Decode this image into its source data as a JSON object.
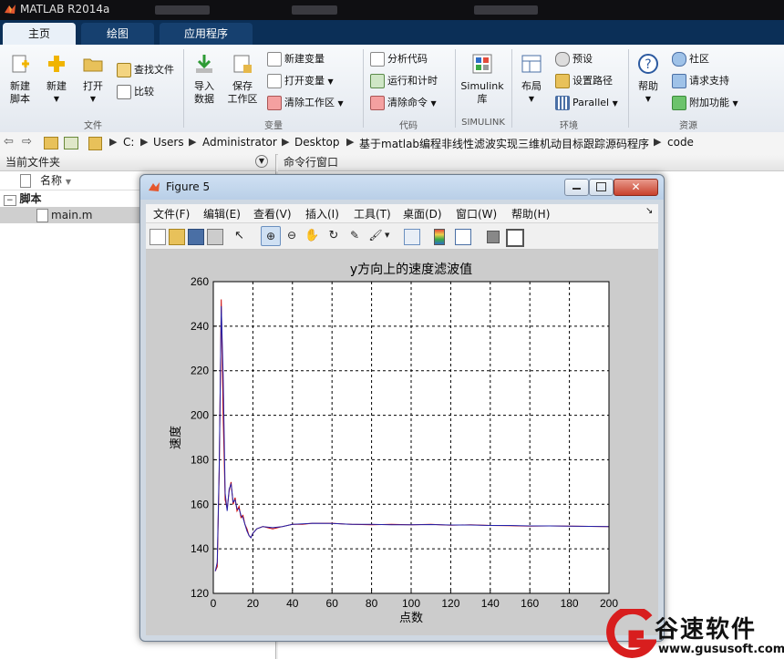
{
  "app": {
    "title": "MATLAB R2014a"
  },
  "tabs": [
    {
      "label": "主页",
      "active": true
    },
    {
      "label": "绘图",
      "active": false
    },
    {
      "label": "应用程序",
      "active": false
    }
  ],
  "ribbon": {
    "file_group": {
      "label": "文件",
      "new_script": "新建\n脚本",
      "new": "新建",
      "open": "打开",
      "find_files": "查找文件",
      "compare": "比较"
    },
    "variable_group": {
      "label": "变量",
      "import_data": "导入\n数据",
      "save_workspace": "保存\n工作区",
      "new_variable": "新建变量",
      "open_variable": "打开变量",
      "clear_workspace": "清除工作区"
    },
    "code_group": {
      "label": "代码",
      "analyze_code": "分析代码",
      "run_and_time": "运行和计时",
      "clear_commands": "清除命令"
    },
    "simulink_group": {
      "label": "SIMULINK",
      "simulink_library": "Simulink\n库"
    },
    "environment_group": {
      "label": "环境",
      "layout": "布局",
      "preferences": "预设",
      "set_path": "设置路径",
      "parallel": "Parallel"
    },
    "resources_group": {
      "label": "资源",
      "help": "帮助",
      "community": "社区",
      "request_support": "请求支持",
      "add_ons": "附加功能"
    }
  },
  "address": {
    "crumbs": [
      "C:",
      "Users",
      "Administrator",
      "Desktop",
      "基于matlab编程非线性滤波实现三维机动目标跟踪源码程序",
      "code"
    ]
  },
  "current_folder": {
    "title": "当前文件夹",
    "column_name": "名称",
    "group": "脚本",
    "file": "main.m"
  },
  "command_window": {
    "title": "命令行窗口"
  },
  "figure": {
    "title": "Figure 5",
    "menu": [
      "文件(F)",
      "编辑(E)",
      "查看(V)",
      "插入(I)",
      "工具(T)",
      "桌面(D)",
      "窗口(W)",
      "帮助(H)"
    ]
  },
  "chart_data": {
    "type": "line",
    "title": "y方向上的速度滤波值",
    "xlabel": "点数",
    "ylabel": "速度",
    "xlim": [
      0,
      200
    ],
    "ylim": [
      120,
      260
    ],
    "xticks": [
      0,
      20,
      40,
      60,
      80,
      100,
      120,
      140,
      160,
      180,
      200
    ],
    "yticks": [
      120,
      140,
      160,
      180,
      200,
      220,
      240,
      260
    ],
    "grid": "dashed",
    "series": [
      {
        "color": "#cc0000",
        "points": [
          [
            1,
            130
          ],
          [
            2,
            132
          ],
          [
            3,
            175
          ],
          [
            4,
            252
          ],
          [
            5,
            200
          ],
          [
            6,
            162
          ],
          [
            7,
            158
          ],
          [
            8,
            166
          ],
          [
            9,
            170
          ],
          [
            10,
            160
          ],
          [
            11,
            163
          ],
          [
            12,
            157
          ],
          [
            13,
            159
          ],
          [
            14,
            154
          ],
          [
            15,
            155
          ],
          [
            16,
            151
          ],
          [
            17,
            149
          ],
          [
            18,
            146
          ],
          [
            19,
            145
          ],
          [
            20,
            147
          ],
          [
            22,
            149
          ],
          [
            25,
            150
          ],
          [
            30,
            149
          ],
          [
            35,
            150
          ],
          [
            40,
            151
          ],
          [
            45,
            151
          ],
          [
            50,
            151.5
          ],
          [
            60,
            151.5
          ],
          [
            70,
            151
          ],
          [
            80,
            150.8
          ],
          [
            90,
            151
          ],
          [
            100,
            150.8
          ],
          [
            110,
            151
          ],
          [
            120,
            150.6
          ],
          [
            130,
            150.8
          ],
          [
            140,
            150.5
          ],
          [
            150,
            150.4
          ],
          [
            160,
            150.2
          ],
          [
            170,
            150.3
          ],
          [
            180,
            150.2
          ],
          [
            190,
            150.1
          ],
          [
            200,
            150
          ]
        ]
      },
      {
        "color": "#2222aa",
        "points": [
          [
            1,
            130
          ],
          [
            2,
            134
          ],
          [
            3,
            178
          ],
          [
            4,
            249
          ],
          [
            5,
            218
          ],
          [
            6,
            165
          ],
          [
            7,
            157
          ],
          [
            8,
            167
          ],
          [
            9,
            169
          ],
          [
            10,
            161
          ],
          [
            11,
            162
          ],
          [
            12,
            158
          ],
          [
            13,
            158
          ],
          [
            14,
            155
          ],
          [
            15,
            154
          ],
          [
            16,
            151
          ],
          [
            17,
            148
          ],
          [
            18,
            146
          ],
          [
            19,
            145
          ],
          [
            20,
            147
          ],
          [
            22,
            149
          ],
          [
            25,
            150
          ],
          [
            30,
            149.5
          ],
          [
            35,
            150
          ],
          [
            40,
            151
          ],
          [
            45,
            151.2
          ],
          [
            50,
            151.5
          ],
          [
            60,
            151.4
          ],
          [
            70,
            151
          ],
          [
            80,
            151
          ],
          [
            90,
            150.8
          ],
          [
            100,
            150.8
          ],
          [
            110,
            150.9
          ],
          [
            120,
            150.7
          ],
          [
            130,
            150.7
          ],
          [
            140,
            150.5
          ],
          [
            150,
            150.5
          ],
          [
            160,
            150.3
          ],
          [
            170,
            150.3
          ],
          [
            180,
            150.2
          ],
          [
            190,
            150.1
          ],
          [
            200,
            150
          ]
        ]
      }
    ]
  },
  "watermark": {
    "brand": "谷速软件",
    "url": "www.gususoft.com"
  }
}
